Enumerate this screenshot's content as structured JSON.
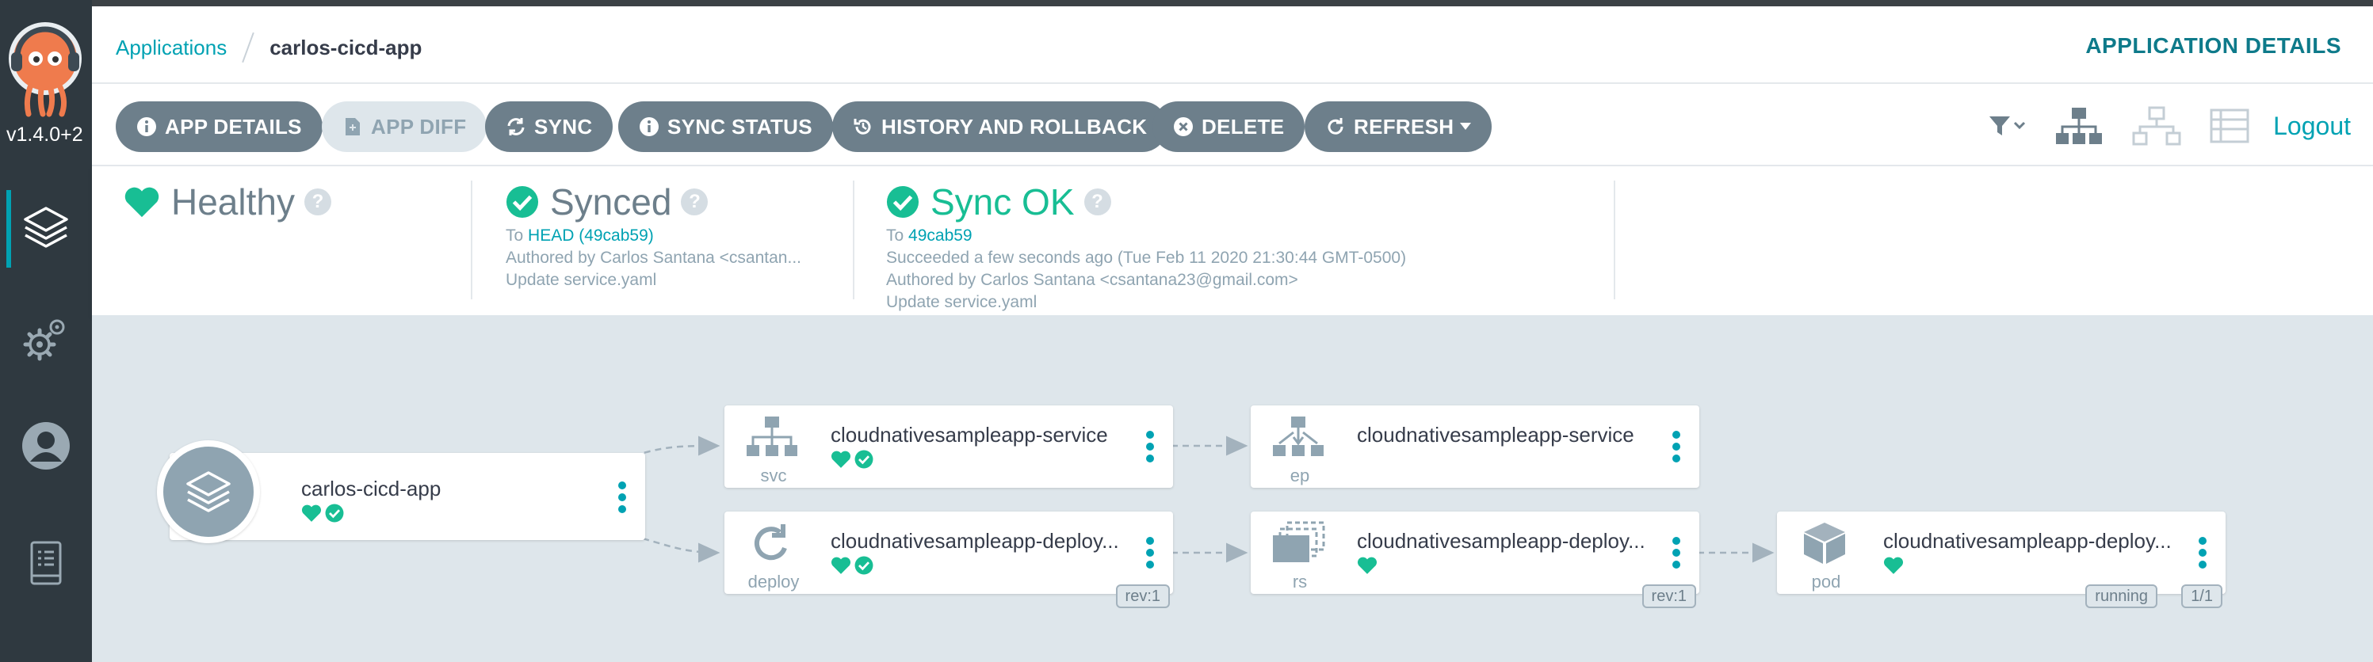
{
  "sidebar": {
    "version": "v1.4.0+2",
    "nav": [
      {
        "name": "applications",
        "icon": "layers-icon"
      },
      {
        "name": "settings",
        "icon": "gears-icon"
      },
      {
        "name": "user-info",
        "icon": "user-icon"
      },
      {
        "name": "docs",
        "icon": "book-icon"
      }
    ]
  },
  "header": {
    "breadcrumb_root": "Applications",
    "breadcrumb_current": "carlos-cicd-app",
    "title": "APPLICATION DETAILS"
  },
  "toolbar": {
    "app_details": "APP DETAILS",
    "app_diff": "APP DIFF",
    "sync": "SYNC",
    "sync_status": "SYNC STATUS",
    "history": "HISTORY AND ROLLBACK",
    "delete": "DELETE",
    "refresh": "REFRESH",
    "logout": "Logout"
  },
  "status": {
    "health": {
      "label": "Healthy"
    },
    "sync": {
      "label": "Synced",
      "to_prefix": "To",
      "to_value": "HEAD (49cab59)",
      "author": "Authored by Carlos Santana <csantan...",
      "message": "Update service.yaml"
    },
    "operation": {
      "label": "Sync OK",
      "to_prefix": "To",
      "to_value": "49cab59",
      "succeeded": "Succeeded a few seconds ago (Tue Feb 11 2020 21:30:44 GMT-0500)",
      "author": "Authored by Carlos Santana <csantana23@gmail.com>",
      "message": "Update service.yaml"
    }
  },
  "graph": {
    "app": {
      "name": "carlos-cicd-app"
    },
    "nodes": [
      {
        "name": "cloudnativesampleapp-service",
        "kind": "svc"
      },
      {
        "name": "cloudnativesampleapp-deploy...",
        "kind": "deploy",
        "tags": [
          "rev:1"
        ]
      },
      {
        "name": "cloudnativesampleapp-service",
        "kind": "ep"
      },
      {
        "name": "cloudnativesampleapp-deploy...",
        "kind": "rs",
        "tags": [
          "rev:1"
        ]
      },
      {
        "name": "cloudnativesampleapp-deploy...",
        "kind": "pod",
        "tags": [
          "running",
          "1/1"
        ]
      }
    ]
  },
  "colors": {
    "accent": "#00a2b3",
    "healthy": "#18be94",
    "sidebar": "#2f3940",
    "button": "#6d7f8b",
    "graph_bg": "#dee6eb"
  }
}
